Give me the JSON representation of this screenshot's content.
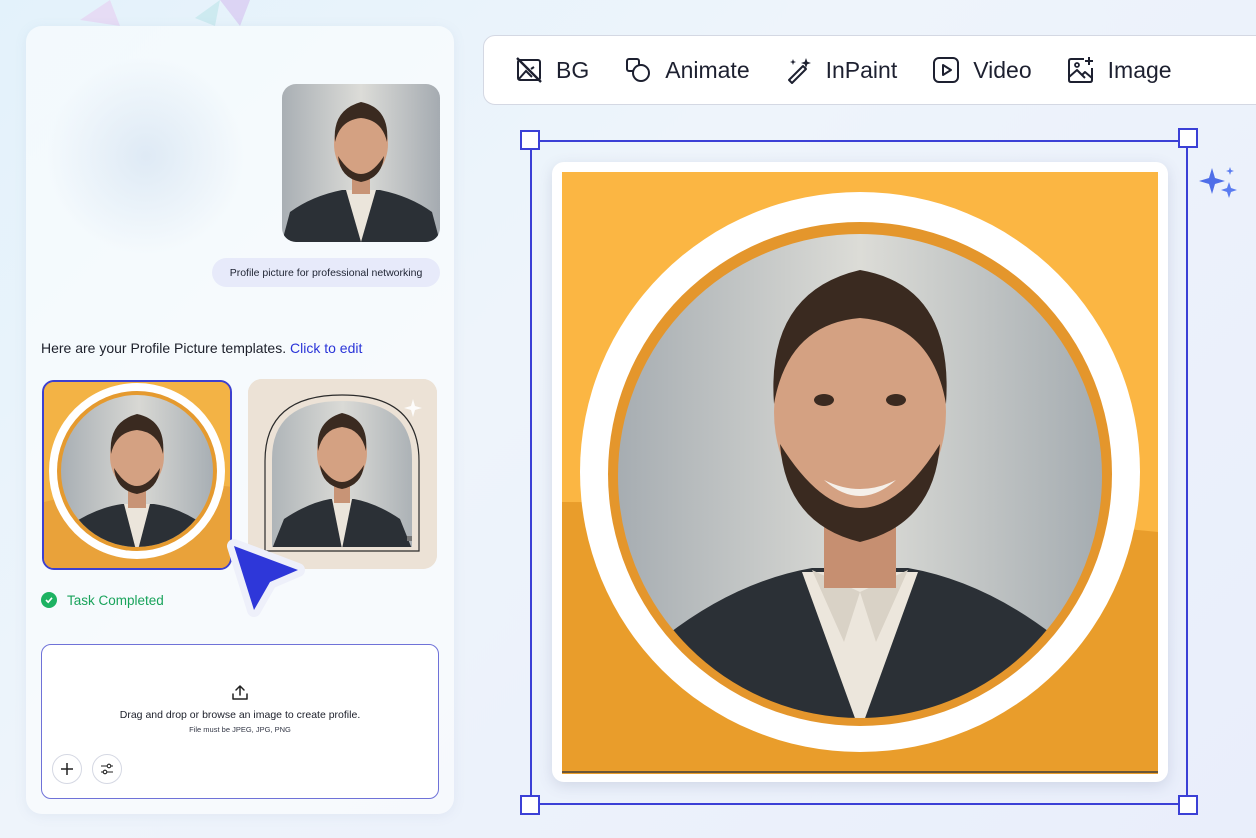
{
  "chat": {
    "user_message": "Profile picture for professional networking",
    "ai_message": "Here are your Profile Picture templates.",
    "ai_link": "Click to edit",
    "status": "Task Completed"
  },
  "upload": {
    "main_text": "Drag and drop or browse an image to create profile.",
    "sub_text": "File must be JPEG, JPG, PNG"
  },
  "toolbar": {
    "tools": [
      {
        "label": "BG",
        "icon": "bg-remove-icon"
      },
      {
        "label": "Animate",
        "icon": "animate-icon"
      },
      {
        "label": "InPaint",
        "icon": "magic-wand-icon"
      },
      {
        "label": "Video",
        "icon": "video-play-icon"
      },
      {
        "label": "Image",
        "icon": "image-add-icon"
      }
    ]
  },
  "colors": {
    "accent": "#3b40d6",
    "template_orange": "#f3b345",
    "success": "#19a35b",
    "link": "#2a34d8"
  }
}
